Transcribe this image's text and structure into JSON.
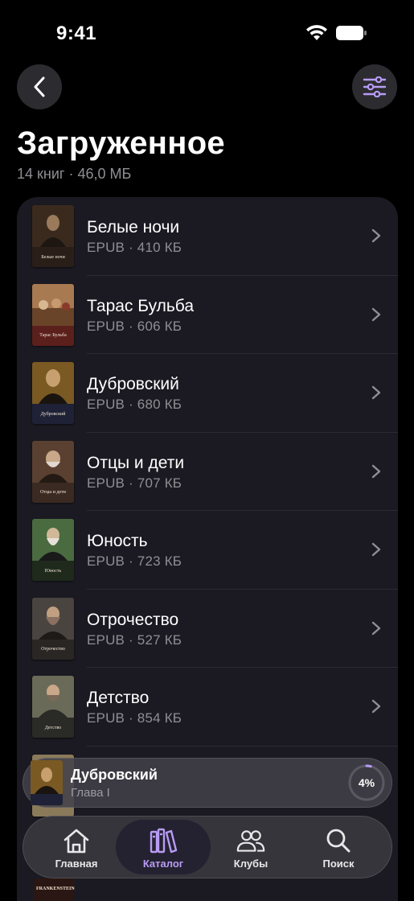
{
  "status_bar": {
    "time": "9:41"
  },
  "header": {
    "title": "Загруженное",
    "subtitle": "14 книг · 46,0 МБ"
  },
  "books": [
    {
      "title": "Белые ночи",
      "meta": "EPUB · 410 КБ",
      "cover_label": "Белые ночи",
      "cover_color": "#3a2a1e",
      "strip_color": "#2a1f18"
    },
    {
      "title": "Тарас Бульба",
      "meta": "EPUB · 606 КБ",
      "cover_label": "Тарас Бульба",
      "cover_color": "#8a5a3a",
      "strip_color": "#5b1f1c"
    },
    {
      "title": "Дубровский",
      "meta": "EPUB · 680 КБ",
      "cover_label": "Дубровский",
      "cover_color": "#6b4a1e",
      "strip_color": "#1f2236"
    },
    {
      "title": "Отцы и дети",
      "meta": "EPUB · 707 КБ",
      "cover_label": "Отцы и дети",
      "cover_color": "#5a4030",
      "strip_color": "#3a2a22"
    },
    {
      "title": "Юность",
      "meta": "EPUB · 723 КБ",
      "cover_label": "Юность",
      "cover_color": "#3e5a36",
      "strip_color": "#1f2a1c"
    },
    {
      "title": "Отрочество",
      "meta": "EPUB · 527 КБ",
      "cover_label": "Отрочество",
      "cover_color": "#4a4440",
      "strip_color": "#2a2624"
    },
    {
      "title": "Детство",
      "meta": "EPUB · 854 КБ",
      "cover_label": "Детство",
      "cover_color": "#5a5a4a",
      "strip_color": "#2a2a26"
    }
  ],
  "now_playing": {
    "title": "Дубровский",
    "subtitle": "Глава I",
    "progress_label": "4%",
    "progress": 0.04,
    "cover_label": "Дубровский"
  },
  "tabs": [
    {
      "label": "Главная",
      "icon": "home-icon",
      "active": false
    },
    {
      "label": "Каталог",
      "icon": "books-icon",
      "active": true
    },
    {
      "label": "Клубы",
      "icon": "people-icon",
      "active": false
    },
    {
      "label": "Поиск",
      "icon": "search-icon",
      "active": false
    }
  ],
  "peek": {
    "label": "FRANKENSTEIN"
  },
  "colors": {
    "accent": "#b89cf5",
    "background": "#000000",
    "card": "#1b1a22",
    "secondary_text": "#8e8e93"
  }
}
